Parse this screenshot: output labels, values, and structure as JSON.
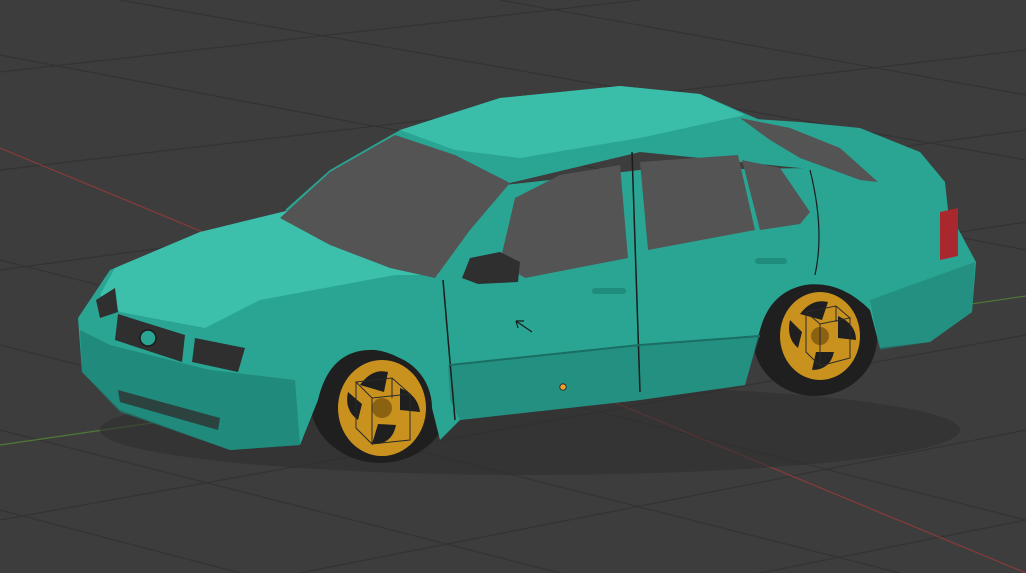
{
  "viewport": {
    "background": "#3d3d3d",
    "grid_color": "#333333",
    "x_axis_color": "#8a3a3a",
    "y_axis_color": "#4e7a36"
  },
  "model": {
    "body_color": "#2aa593",
    "body_shadow": "#1d7f72",
    "body_highlight": "#3cc0ac",
    "glass_color": "#545454",
    "trim_color": "#2f2f2f",
    "wheel_color": "#c9921e",
    "wheel_dark": "#8a6212",
    "tire_color": "#1f1f1f",
    "taillight_color": "#a8282d"
  },
  "origin_marker_color": "#f0a030",
  "cursor_icon": "arrow-cursor-icon"
}
